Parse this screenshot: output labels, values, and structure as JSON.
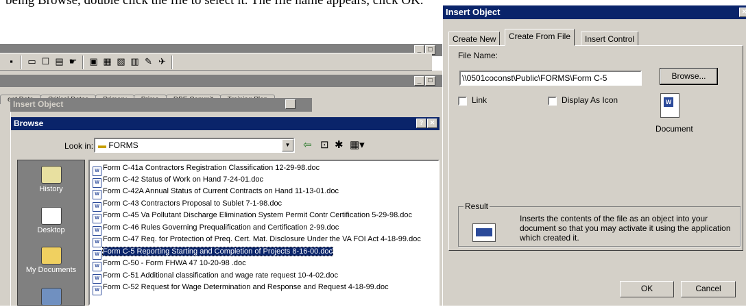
{
  "top_text": "being Browse, double click the file to select it. The file name appears, click OK.",
  "left_window": {
    "min_label": "_",
    "restore_label": "□",
    "close_label": "✕",
    "tabs": [
      "ent Data",
      "Critical Dates",
      "Primary",
      "Prime",
      "DBE Commit",
      "Training Plan"
    ],
    "insert_object_title": "Insert Object",
    "browse_dialog": {
      "title": "Browse",
      "help_label": "?",
      "close_label": "✕",
      "look_in_label": "Look in:",
      "look_in_value": "FORMS",
      "places": [
        "History",
        "Desktop",
        "My Documents"
      ],
      "files": [
        "Form C-41a Contractors Registration Classification 12-29-98.doc",
        "Form C-42 Status of Work on Hand 7-24-01.doc",
        "Form C-42A Annual Status of Current Contracts on Hand 11-13-01.doc",
        "Form C-43 Contractors Proposal to Sublet 7-1-98.doc",
        "Form C-45 Va Pollutant Discharge Elimination System Permit Contr Certification 5-29-98.doc",
        "Form C-46 Rules Governing Prequalification and Certification 2-99.doc",
        "Form C-47 Req. for Protection of Preq. Cert. Mat. Disclosure Under the VA FOI Act 4-18-99.doc",
        "Form C-5 Reporting Starting and Completion of Projects  8-16-00.doc",
        "Form C-50 - Form  FHWA 47 10-20-98 .doc",
        "Form C-51 Additional classification and wage rate request 10-4-02.doc",
        "Form C-52 Request for Wage Determination and Response and Request 4-18-99.doc"
      ],
      "selected_index": 7
    }
  },
  "right_dialog": {
    "title": "Insert Object",
    "close_label": "✕",
    "tabs": [
      "Create New",
      "Create From File",
      "Insert Control"
    ],
    "active_tab": 1,
    "file_name_label": "File Name:",
    "file_name_value": "\\\\0501coconst\\Public\\FORMS\\Form C-5",
    "browse_button": "Browse...",
    "link_label": "Link",
    "display_as_icon_label": "Display As Icon",
    "icon_caption": "Document",
    "result_label": "Result",
    "result_text": "Inserts the contents of the file as an object into your document so that you may activate it using the application which created it.",
    "ok_button": "OK",
    "cancel_button": "Cancel"
  }
}
